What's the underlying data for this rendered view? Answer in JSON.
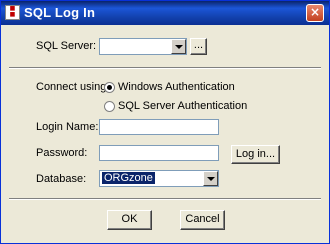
{
  "window": {
    "title": "SQL Log In",
    "icon": "db-icon",
    "close_glyph": "×"
  },
  "server": {
    "label": "SQL Server:",
    "value": "",
    "browse_label": "..."
  },
  "connect": {
    "label": "Connect using:",
    "options": [
      {
        "label": "Windows Authentication",
        "selected": true
      },
      {
        "label": "SQL Server Authentication",
        "selected": false
      }
    ]
  },
  "login": {
    "name_label": "Login Name:",
    "name_value": "",
    "password_label": "Password:",
    "password_value": "",
    "login_button": "Log in..."
  },
  "database": {
    "label": "Database:",
    "value": "ORGzone"
  },
  "footer": {
    "ok_label": "OK",
    "cancel_label": "Cancel"
  }
}
